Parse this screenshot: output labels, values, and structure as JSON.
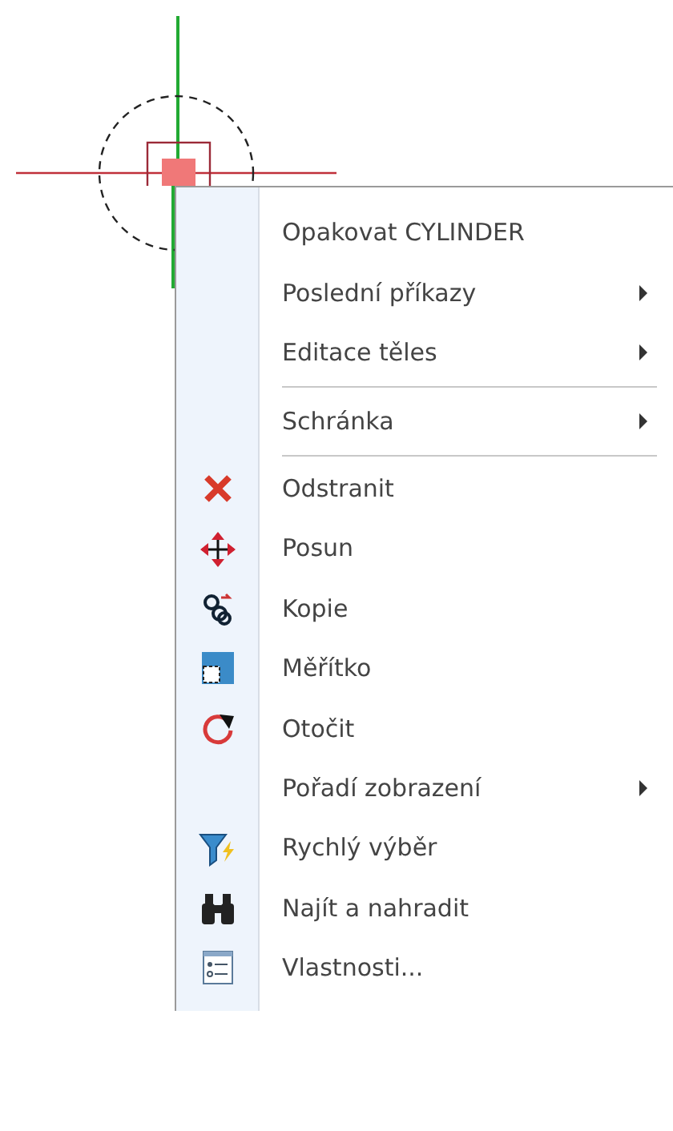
{
  "context_menu": {
    "items": [
      {
        "kind": "command",
        "label": "Opakovat CYLINDER"
      },
      {
        "kind": "submenu",
        "label": "Poslední příkazy"
      },
      {
        "kind": "submenu",
        "label": "Editace těles"
      },
      {
        "kind": "separator"
      },
      {
        "kind": "submenu",
        "label": "Schránka"
      },
      {
        "kind": "separator"
      },
      {
        "kind": "command",
        "label": "Odstranit"
      },
      {
        "kind": "command",
        "label": "Posun"
      },
      {
        "kind": "command",
        "label": "Kopie"
      },
      {
        "kind": "command",
        "label": "Měřítko"
      },
      {
        "kind": "command",
        "label": "Otočit"
      },
      {
        "kind": "submenu",
        "label": "Pořadí zobrazení"
      },
      {
        "kind": "command",
        "label": "Rychlý výběr"
      },
      {
        "kind": "command",
        "label": "Najít a nahradit"
      },
      {
        "kind": "command",
        "label": "Vlastnosti..."
      }
    ]
  }
}
